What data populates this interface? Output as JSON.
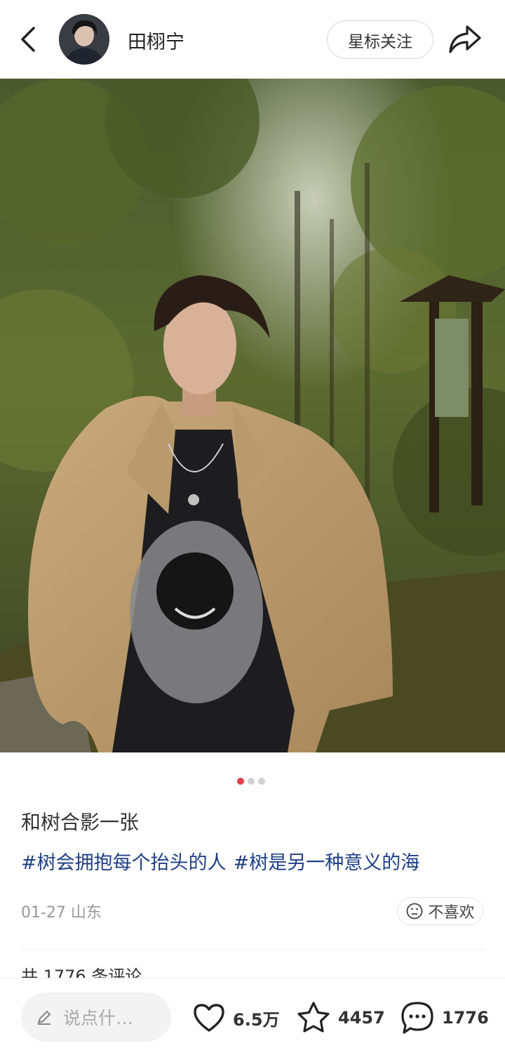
{
  "header": {
    "username": "田栩宁",
    "follow_label": "星标关注"
  },
  "post": {
    "title": "和树合影一张",
    "tags": [
      "#树会拥抱每个抬头的人",
      "#树是另一种意义的海"
    ],
    "date_location": "01-27 山东",
    "dislike_label": "不喜欢",
    "image_index": 1,
    "image_count": 3,
    "comments_heading": "共 1776 条评论"
  },
  "bottom_bar": {
    "comment_placeholder": "说点什…",
    "likes": "6.5万",
    "favorites": "4457",
    "comments": "1776"
  },
  "colors": {
    "accent_red": "#e0424f",
    "tag_blue": "#1e3f86"
  },
  "icons": [
    "back-arrow-icon",
    "share-icon",
    "smile-neutral-icon",
    "pencil-icon",
    "heart-icon",
    "star-icon",
    "comment-bubble-icon"
  ]
}
